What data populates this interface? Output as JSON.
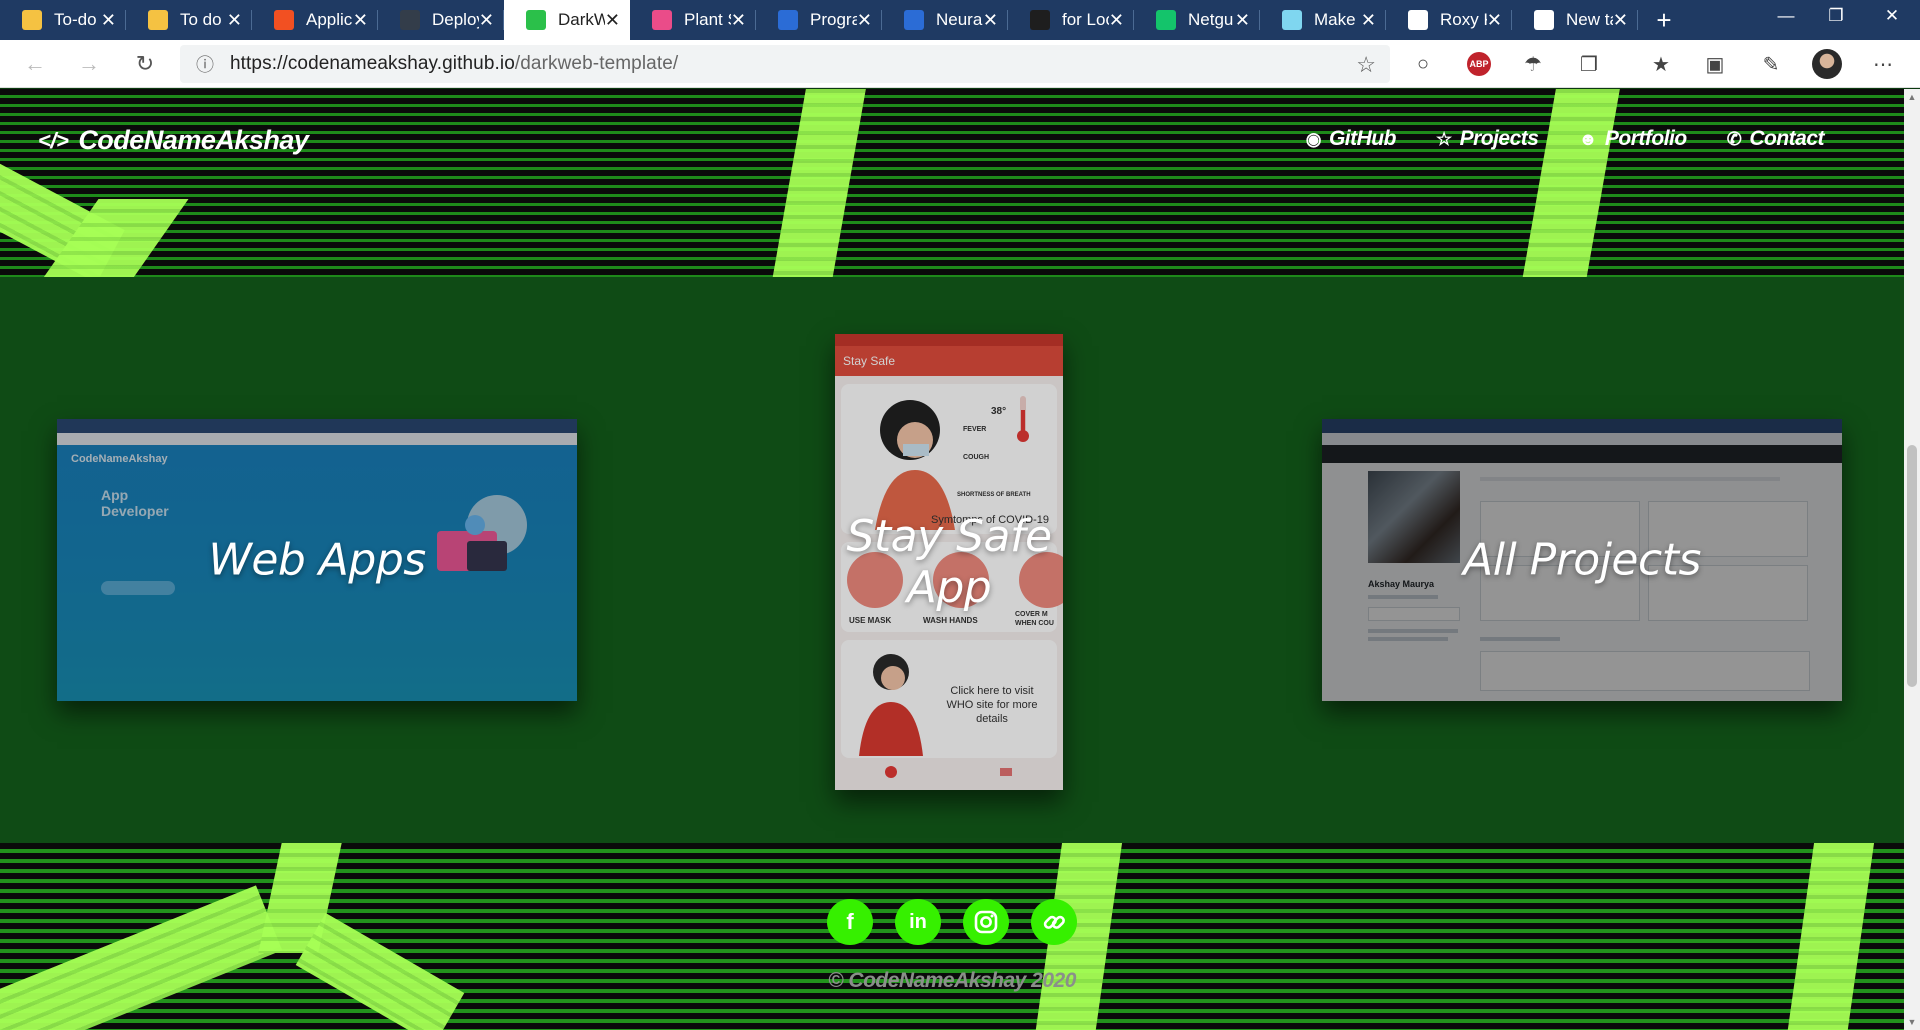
{
  "browser": {
    "tabs": [
      {
        "title": "To-do",
        "fav_color": "#f5c242"
      },
      {
        "title": "To do",
        "fav_color": "#f5c242"
      },
      {
        "title": "Applic",
        "fav_color": "#f25022"
      },
      {
        "title": "Deploy",
        "fav_color": "#333d4a"
      },
      {
        "title": "DarkW",
        "fav_color": "#2bc04a",
        "active": true
      },
      {
        "title": "Plant S",
        "fav_color": "#ea4c89"
      },
      {
        "title": "Progra",
        "fav_color": "#2b6cd6"
      },
      {
        "title": "Neural",
        "fav_color": "#2b6cd6"
      },
      {
        "title": "for Loc",
        "fav_color": "#1e1e1e"
      },
      {
        "title": "Netgu",
        "fav_color": "#14c46b"
      },
      {
        "title": "Make I",
        "fav_color": "#7fd6f0"
      },
      {
        "title": "Roxy K",
        "fav_color": "#ffffff"
      },
      {
        "title": "New ta",
        "fav_color": "#ffffff"
      }
    ],
    "url_host": "https://codenameakshay.github.io",
    "url_path": "/darkweb-template/",
    "abp_label": "ABP"
  },
  "site": {
    "logo_code": "</>",
    "logo_text": "CodeNameAkshay",
    "nav": [
      {
        "label": "GitHub",
        "icon": "github-icon"
      },
      {
        "label": "Projects",
        "icon": "star-icon"
      },
      {
        "label": "Portfolio",
        "icon": "user-circle-icon"
      },
      {
        "label": "Contact",
        "icon": "phone-icon"
      }
    ],
    "cards": [
      {
        "title": "Web Apps"
      },
      {
        "title": "Stay Safe App"
      },
      {
        "title": "All Projects"
      }
    ],
    "web_thumb": {
      "logo": "CodeNameAkshay",
      "heading_1": "App",
      "heading_2": "Developer"
    },
    "phone_thumb": {
      "app_title": "Stay Safe",
      "symptom_1": "FEVER",
      "symptom_2": "COUGH",
      "symptom_3": "SHORTNESS OF BREATH",
      "temp": "38°",
      "symptoms_caption": "Symtomps of COVID-19",
      "tip_1": "USE MASK",
      "tip_2": "WASH HANDS",
      "tip_3": "COVER M WHEN COU",
      "who_text": "Click here to visit WHO site for more details"
    },
    "gh_thumb": {
      "name": "Akshay Maurya"
    },
    "socials": [
      "facebook-icon",
      "linkedin-icon",
      "instagram-icon",
      "link-icon"
    ],
    "copyright": "© CodeNameAkshay 2020"
  }
}
